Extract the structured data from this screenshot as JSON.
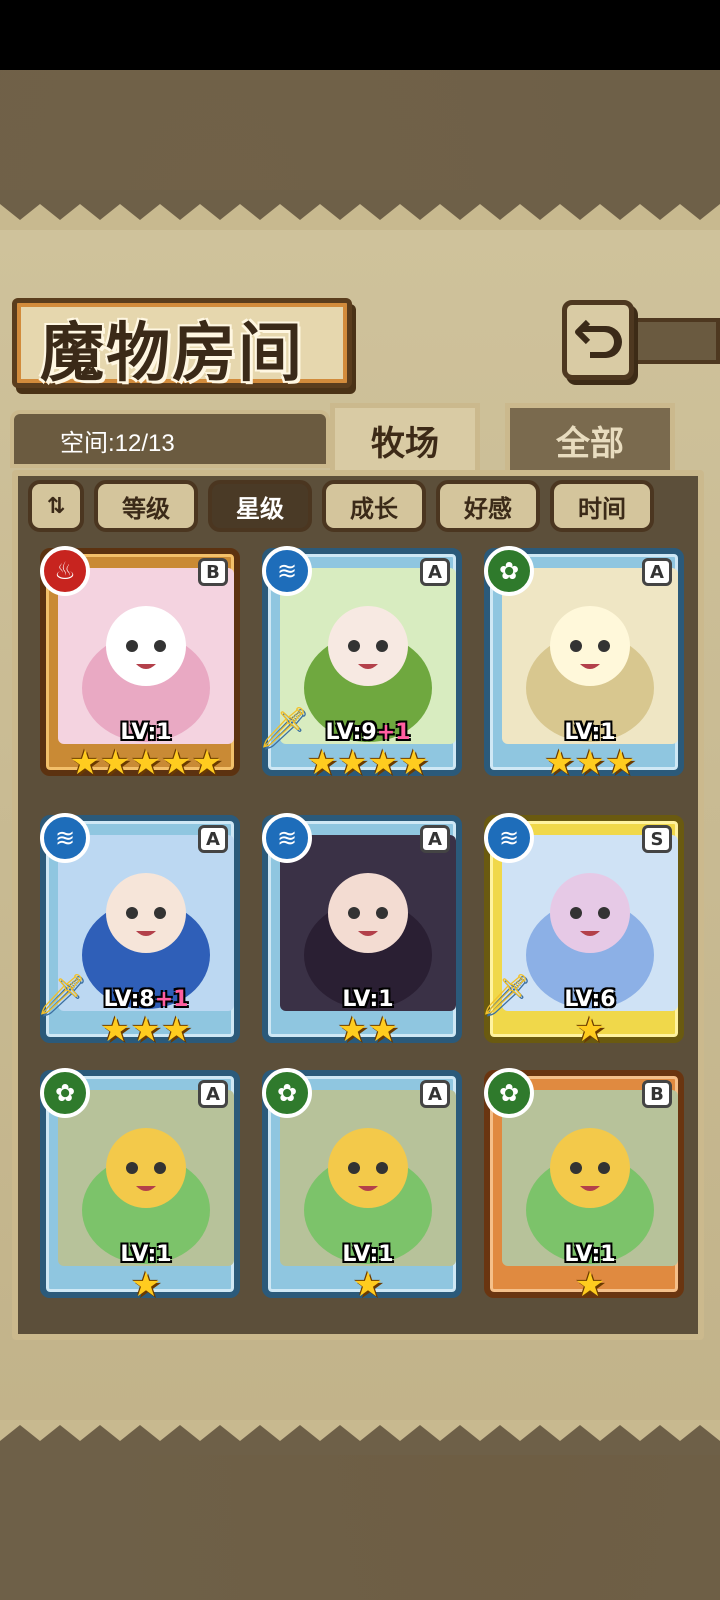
{
  "header": {
    "title": "魔物房间",
    "back_icon": "return-icon"
  },
  "tabs": {
    "space_label": "空间:12/13",
    "ranch": "牧场",
    "all": "全部"
  },
  "sort": {
    "toggle_label": "⇅",
    "buttons": [
      "等级",
      "星级",
      "成长",
      "好感",
      "时间"
    ],
    "active": "星级"
  },
  "cards": [
    {
      "element": "fire",
      "rank": "B",
      "lv_text": "LV:1",
      "plus": "",
      "stars": "★★★★★",
      "frame": "gold",
      "sword": false,
      "art": "pink-girl"
    },
    {
      "element": "water",
      "rank": "A",
      "lv_text": "LV:9",
      "plus": "+1",
      "stars": "★★★★",
      "frame": "blue",
      "sword": true,
      "art": "green-hair-girl"
    },
    {
      "element": "grass",
      "rank": "A",
      "lv_text": "LV:1",
      "plus": "",
      "stars": "★★★",
      "frame": "blue",
      "sword": false,
      "art": "blonde-fairy"
    },
    {
      "element": "water",
      "rank": "A",
      "lv_text": "LV:8",
      "plus": "+1",
      "stars": "★★★",
      "frame": "blue",
      "sword": true,
      "art": "blue-cat-girl"
    },
    {
      "element": "water",
      "rank": "A",
      "lv_text": "LV:1",
      "plus": "",
      "stars": "★★",
      "frame": "blue",
      "sword": false,
      "art": "dark-hair-girl"
    },
    {
      "element": "water",
      "rank": "S",
      "lv_text": "LV:6",
      "plus": "",
      "stars": "★",
      "frame": "yellow",
      "sword": true,
      "art": "blue-slime"
    },
    {
      "element": "grass",
      "rank": "A",
      "lv_text": "LV:1",
      "plus": "",
      "stars": "★",
      "frame": "blue",
      "sword": false,
      "art": "green-slime"
    },
    {
      "element": "grass",
      "rank": "A",
      "lv_text": "LV:1",
      "plus": "",
      "stars": "★",
      "frame": "blue",
      "sword": false,
      "art": "green-slime"
    },
    {
      "element": "grass",
      "rank": "B",
      "lv_text": "LV:1",
      "plus": "",
      "stars": "★",
      "frame": "orange",
      "sword": false,
      "art": "green-slime"
    }
  ]
}
